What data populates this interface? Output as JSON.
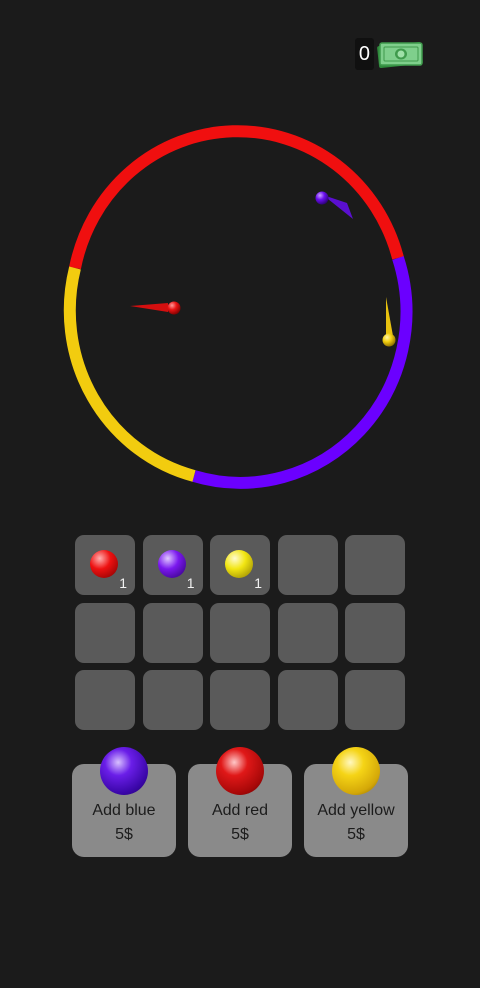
{
  "hud": {
    "money": "0",
    "money_icon": "banknote-icon"
  },
  "arena": {
    "ring": [
      {
        "color": "red",
        "hex": "#f00f0f"
      },
      {
        "color": "blue",
        "hex": "#6b00ff"
      },
      {
        "color": "yellow",
        "hex": "#f2cc0f"
      }
    ],
    "balls": [
      {
        "color": "red",
        "hex": "#e81010"
      },
      {
        "color": "blue",
        "hex": "#6a0ef0"
      },
      {
        "color": "yellow",
        "hex": "#f3d010"
      }
    ]
  },
  "inventory": {
    "slots": [
      {
        "ball": "red",
        "hex": "#ee1111",
        "count": "1"
      },
      {
        "ball": "blue",
        "hex": "#7a18ee",
        "count": "1"
      },
      {
        "ball": "yellow",
        "hex": "#f2e612",
        "count": "1"
      },
      {},
      {},
      {},
      {},
      {},
      {},
      {},
      {},
      {},
      {},
      {},
      {}
    ]
  },
  "shop": {
    "items": [
      {
        "label": "Add blue",
        "price": "5$",
        "hex": "#5010cf"
      },
      {
        "label": "Add red",
        "price": "5$",
        "hex": "#c80c0c"
      },
      {
        "label": "Add yellow",
        "price": "5$",
        "hex": "#f2cc0f"
      }
    ]
  }
}
